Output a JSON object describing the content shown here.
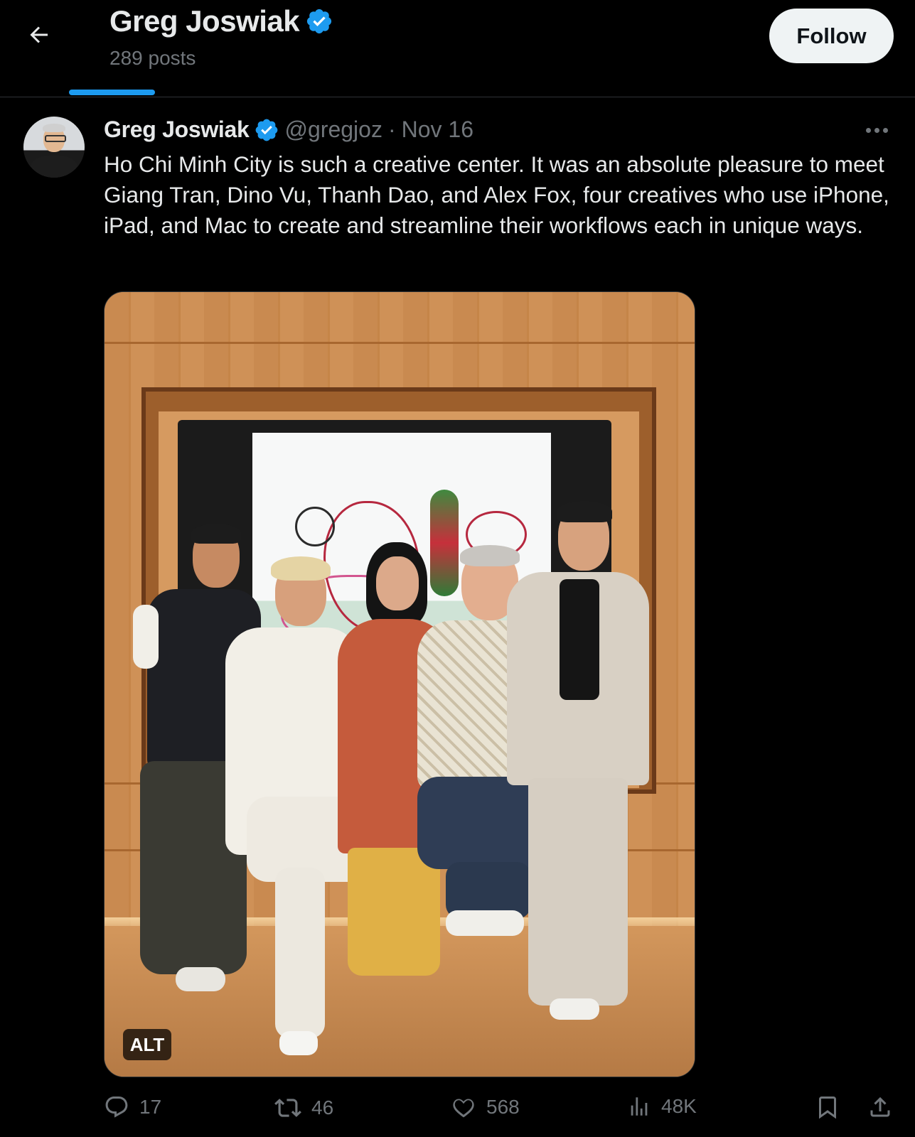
{
  "header": {
    "name": "Greg Joswiak",
    "post_count": "289 posts",
    "follow_label": "Follow"
  },
  "post": {
    "author_name": "Greg Joswiak",
    "handle": "@gregjoz",
    "separator": "·",
    "date": "Nov 16",
    "text": "Ho Chi Minh City is such a creative center. It was an absolute pleasure to meet Giang Tran, Dino Vu, Thanh Dao, and Alex Fox, four creatives who use iPhone, iPad, and Mac to create and streamline their workflows each in unique ways.",
    "media_alt_label": "ALT"
  },
  "actions": {
    "replies": "17",
    "reposts": "46",
    "likes": "568",
    "views": "48K"
  },
  "colors": {
    "background": "#000000",
    "text_primary": "#e7e9ea",
    "text_secondary": "#71767b",
    "accent": "#1d9bf0",
    "follow_bg": "#eff3f4"
  },
  "icons": [
    "back-arrow-icon",
    "verified-badge-icon",
    "more-icon",
    "reply-icon",
    "repost-icon",
    "like-icon",
    "views-icon",
    "bookmark-icon",
    "share-icon"
  ]
}
